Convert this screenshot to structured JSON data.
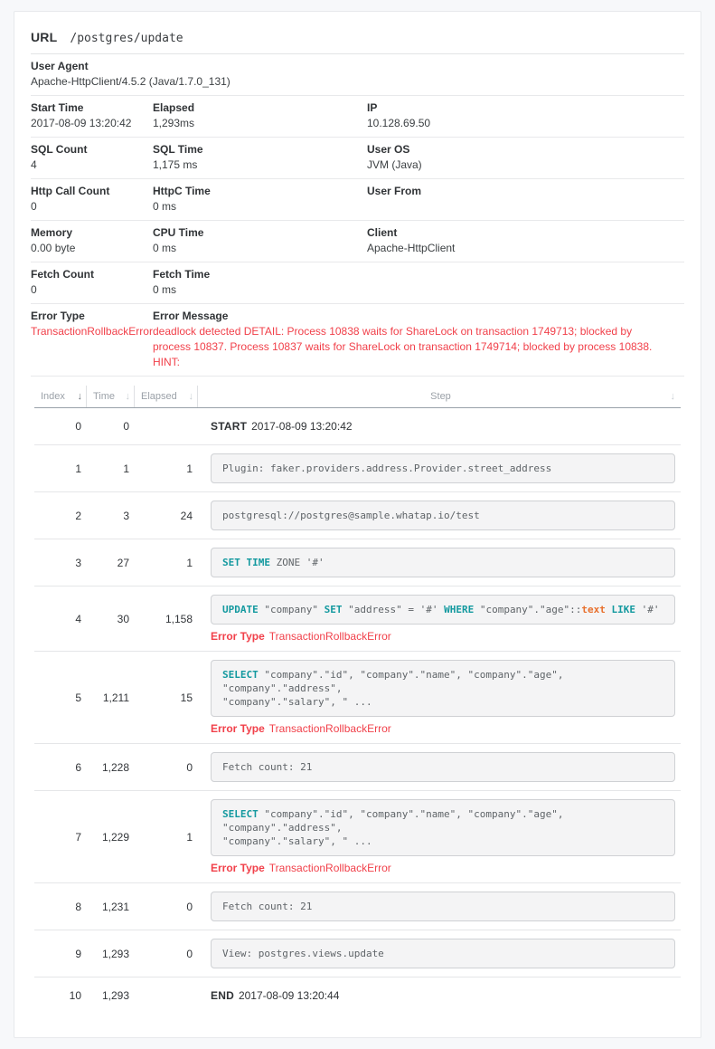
{
  "header": {
    "label": "URL",
    "url": "/postgres/update"
  },
  "details": {
    "user_agent": {
      "label": "User Agent",
      "value": "Apache-HttpClient/4.5.2 (Java/1.7.0_131)"
    },
    "start_time": {
      "label": "Start Time",
      "value": "2017-08-09 13:20:42"
    },
    "elapsed": {
      "label": "Elapsed",
      "value": "1,293ms"
    },
    "ip": {
      "label": "IP",
      "value": "10.128.69.50"
    },
    "sql_count": {
      "label": "SQL Count",
      "value": "4"
    },
    "sql_time": {
      "label": "SQL Time",
      "value": "1,175 ms"
    },
    "user_os": {
      "label": "User OS",
      "value": "JVM (Java)"
    },
    "http_call_count": {
      "label": "Http Call Count",
      "value": "0"
    },
    "httpc_time": {
      "label": "HttpC Time",
      "value": "0 ms"
    },
    "user_from": {
      "label": "User From",
      "value": ""
    },
    "memory": {
      "label": "Memory",
      "value": "0.00 byte"
    },
    "cpu_time": {
      "label": "CPU Time",
      "value": "0 ms"
    },
    "client": {
      "label": "Client",
      "value": "Apache-HttpClient"
    },
    "fetch_count": {
      "label": "Fetch Count",
      "value": "0"
    },
    "fetch_time": {
      "label": "Fetch Time",
      "value": "0 ms"
    },
    "error_type": {
      "label": "Error Type",
      "value": "TransactionRollbackError"
    },
    "error_message": {
      "label": "Error Message",
      "value": "deadlock detected DETAIL: Process 10838 waits for ShareLock on transaction 1749713; blocked by process 10837. Process 10837 waits for ShareLock on transaction 1749714; blocked by process 10838. HINT:"
    }
  },
  "table": {
    "columns": {
      "index": "Index",
      "time": "Time",
      "elapsed": "Elapsed",
      "step": "Step"
    },
    "sort_arrow": "↓",
    "rows": [
      {
        "index": "0",
        "time": "0",
        "elapsed": "",
        "marker": "START",
        "text": "2017-08-09 13:20:42"
      },
      {
        "index": "1",
        "time": "1",
        "elapsed": "1",
        "text": "Plugin: faker.providers.address.Provider.street_address"
      },
      {
        "index": "2",
        "time": "3",
        "elapsed": "24",
        "text": "postgresql://postgres@sample.whatap.io/test"
      },
      {
        "index": "3",
        "time": "27",
        "elapsed": "1",
        "segments": [
          "SET TIME",
          " ZONE '#'"
        ]
      },
      {
        "index": "4",
        "time": "30",
        "elapsed": "1,158",
        "segments": [
          "UPDATE",
          " \"company\" ",
          "SET",
          " \"address\" = '#' ",
          "WHERE",
          " \"company\".\"age\"::",
          "text",
          " ",
          "LIKE",
          " '#'"
        ],
        "error_label": "Error Type",
        "error_value": "TransactionRollbackError"
      },
      {
        "index": "5",
        "time": "1,211",
        "elapsed": "15",
        "segments": [
          "SELECT",
          " \"company\".\"id\", \"company\".\"name\", \"company\".\"age\", \"company\".\"address\",\n\"company\".\"salary\", \" ..."
        ],
        "error_label": "Error Type",
        "error_value": "TransactionRollbackError"
      },
      {
        "index": "6",
        "time": "1,228",
        "elapsed": "0",
        "text": "Fetch count: 21"
      },
      {
        "index": "7",
        "time": "1,229",
        "elapsed": "1",
        "segments": [
          "SELECT",
          " \"company\".\"id\", \"company\".\"name\", \"company\".\"age\", \"company\".\"address\",\n\"company\".\"salary\", \" ..."
        ],
        "error_label": "Error Type",
        "error_value": "TransactionRollbackError"
      },
      {
        "index": "8",
        "time": "1,231",
        "elapsed": "0",
        "text": "Fetch count: 21"
      },
      {
        "index": "9",
        "time": "1,293",
        "elapsed": "0",
        "text": "View: postgres.views.update"
      },
      {
        "index": "10",
        "time": "1,293",
        "elapsed": "",
        "marker": "END",
        "text": "2017-08-09 13:20:44"
      }
    ]
  },
  "colors": {
    "error_red": "#f1404a",
    "keyword_teal": "#13999f",
    "keyword_orange": "#e8702d"
  }
}
